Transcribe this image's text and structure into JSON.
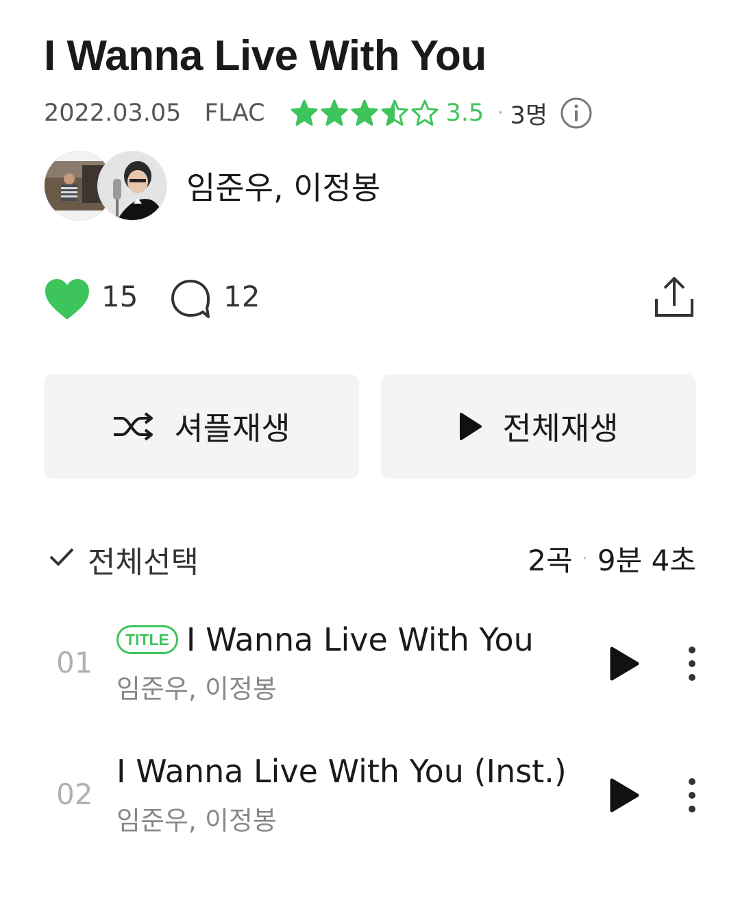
{
  "album": {
    "title": "I Wanna Live With You",
    "date": "2022.03.05",
    "format": "FLAC",
    "rating": 3.5,
    "rating_text": "3.5",
    "rating_count": "3명",
    "artists": "임준우, 이정봉"
  },
  "social": {
    "likes": "15",
    "comments": "12"
  },
  "buttons": {
    "shuffle": "셔플재생",
    "play_all": "전체재생"
  },
  "tracklist": {
    "select_all": "전체선택",
    "track_count": "2곡",
    "duration": "9분 4초",
    "tracks": [
      {
        "number": "01",
        "title": "I Wanna Live With You",
        "badge": "TITLE",
        "artist": "임준우, 이정봉"
      },
      {
        "number": "02",
        "title": "I Wanna Live With You (Inst.)",
        "artist": "임준우, 이정봉"
      }
    ]
  },
  "colors": {
    "accent": "#3dc45a",
    "button_bg": "#f4f4f4",
    "muted_text": "#888888"
  },
  "icons": [
    "star-icon",
    "info-icon",
    "heart-icon",
    "comment-icon",
    "share-icon",
    "shuffle-icon",
    "play-icon",
    "check-icon",
    "more-icon"
  ]
}
